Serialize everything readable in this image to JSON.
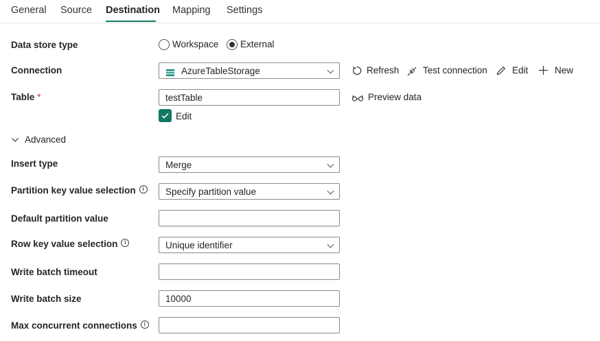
{
  "tabs": [
    "General",
    "Source",
    "Destination",
    "Mapping",
    "Settings"
  ],
  "active_tab": "Destination",
  "accent_color": "#117865",
  "data_store_type": {
    "label": "Data store type",
    "options": [
      "Workspace",
      "External"
    ],
    "selected": "External"
  },
  "connection": {
    "label": "Connection",
    "value": "AzureTableStorage",
    "actions": {
      "refresh": "Refresh",
      "test": "Test connection",
      "edit": "Edit",
      "new": "New"
    }
  },
  "table": {
    "label": "Table",
    "required_mark": "*",
    "value": "testTable",
    "preview": "Preview data",
    "edit_checkbox_label": "Edit",
    "edit_checked": true
  },
  "advanced": {
    "label": "Advanced",
    "insert_type": {
      "label": "Insert type",
      "value": "Merge"
    },
    "partition_key": {
      "label": "Partition key value selection",
      "value": "Specify partition value"
    },
    "default_partition": {
      "label": "Default partition value",
      "value": ""
    },
    "row_key": {
      "label": "Row key value selection",
      "value": "Unique identifier"
    },
    "write_batch_timeout": {
      "label": "Write batch timeout",
      "value": ""
    },
    "write_batch_size": {
      "label": "Write batch size",
      "value": "10000"
    },
    "max_concurrent": {
      "label": "Max concurrent connections",
      "value": ""
    }
  },
  "info_glyph": "i"
}
